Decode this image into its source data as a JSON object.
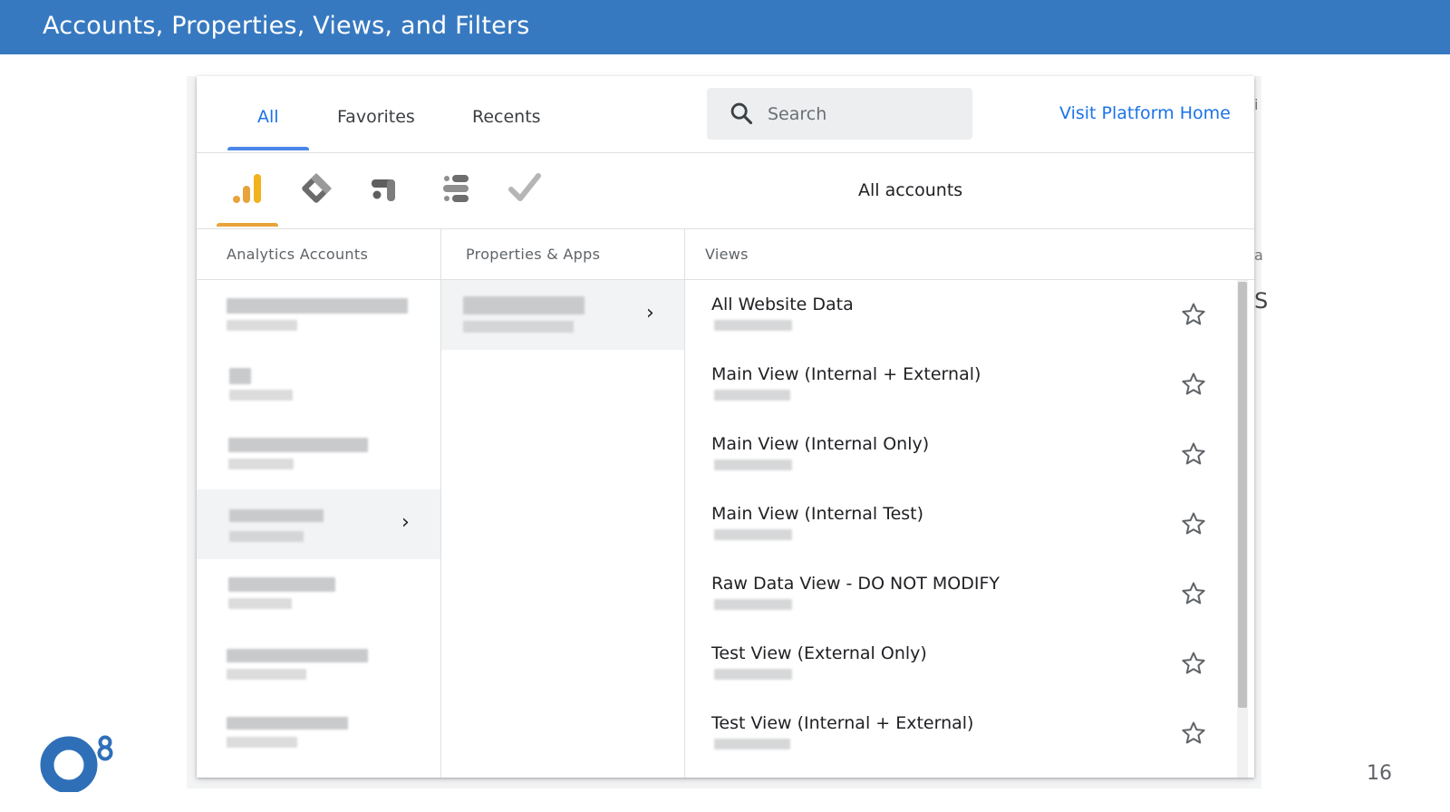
{
  "slide": {
    "title": "Accounts, Properties, Views, and Filters",
    "page_number": "16"
  },
  "tabs": [
    {
      "label": "All",
      "active": true
    },
    {
      "label": "Favorites",
      "active": false
    },
    {
      "label": "Recents",
      "active": false
    }
  ],
  "search": {
    "placeholder": "Search",
    "value": ""
  },
  "visit_link": "Visit Platform Home",
  "products": [
    {
      "icon": "analytics-icon",
      "active": true
    },
    {
      "icon": "tag-manager-icon",
      "active": false
    },
    {
      "icon": "optimize-icon",
      "active": false
    },
    {
      "icon": "data-studio-icon",
      "active": false
    },
    {
      "icon": "surveys-icon",
      "active": false
    }
  ],
  "scope_label": "All accounts",
  "columns": {
    "accounts": "Analytics Accounts",
    "properties": "Properties & Apps",
    "views": "Views"
  },
  "accounts_selected_index": 3,
  "views": [
    {
      "name": "All Website Data"
    },
    {
      "name": "Main View (Internal + External)"
    },
    {
      "name": "Main View (Internal Only)"
    },
    {
      "name": "Main View (Internal Test)"
    },
    {
      "name": "Raw Data View - DO NOT MODIFY"
    },
    {
      "name": "Test View (External Only)"
    },
    {
      "name": "Test View (Internal + External)"
    }
  ],
  "colors": {
    "header": "#3779c0",
    "accent_blue": "#1a73e8",
    "analytics_orange": "#e8a33a"
  }
}
